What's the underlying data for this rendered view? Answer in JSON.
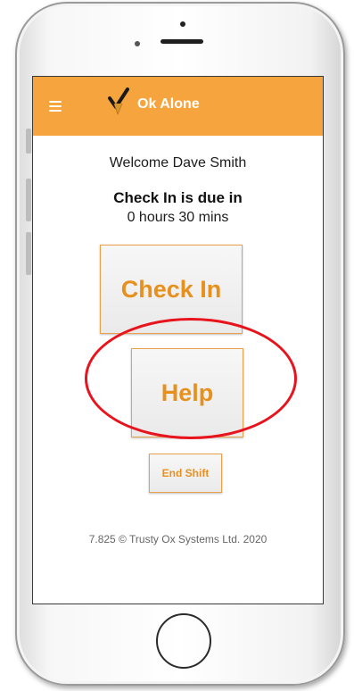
{
  "app": {
    "title": "Ok Alone",
    "brand_color": "#f6a43d",
    "accent_color": "#e8901d"
  },
  "header": {
    "menu_icon": "hamburger-menu-icon",
    "logo_icon": "checkmark-logo-icon"
  },
  "main": {
    "welcome_text": "Welcome Dave Smith",
    "due_label": "Check In is due in",
    "due_value": "0 hours 30 mins",
    "check_in_label": "Check In",
    "help_label": "Help",
    "end_shift_label": "End Shift"
  },
  "footer": {
    "version_text": "7.825 © Trusty Ox Systems Ltd. 2020"
  },
  "annotation": {
    "color": "#e8141d"
  }
}
